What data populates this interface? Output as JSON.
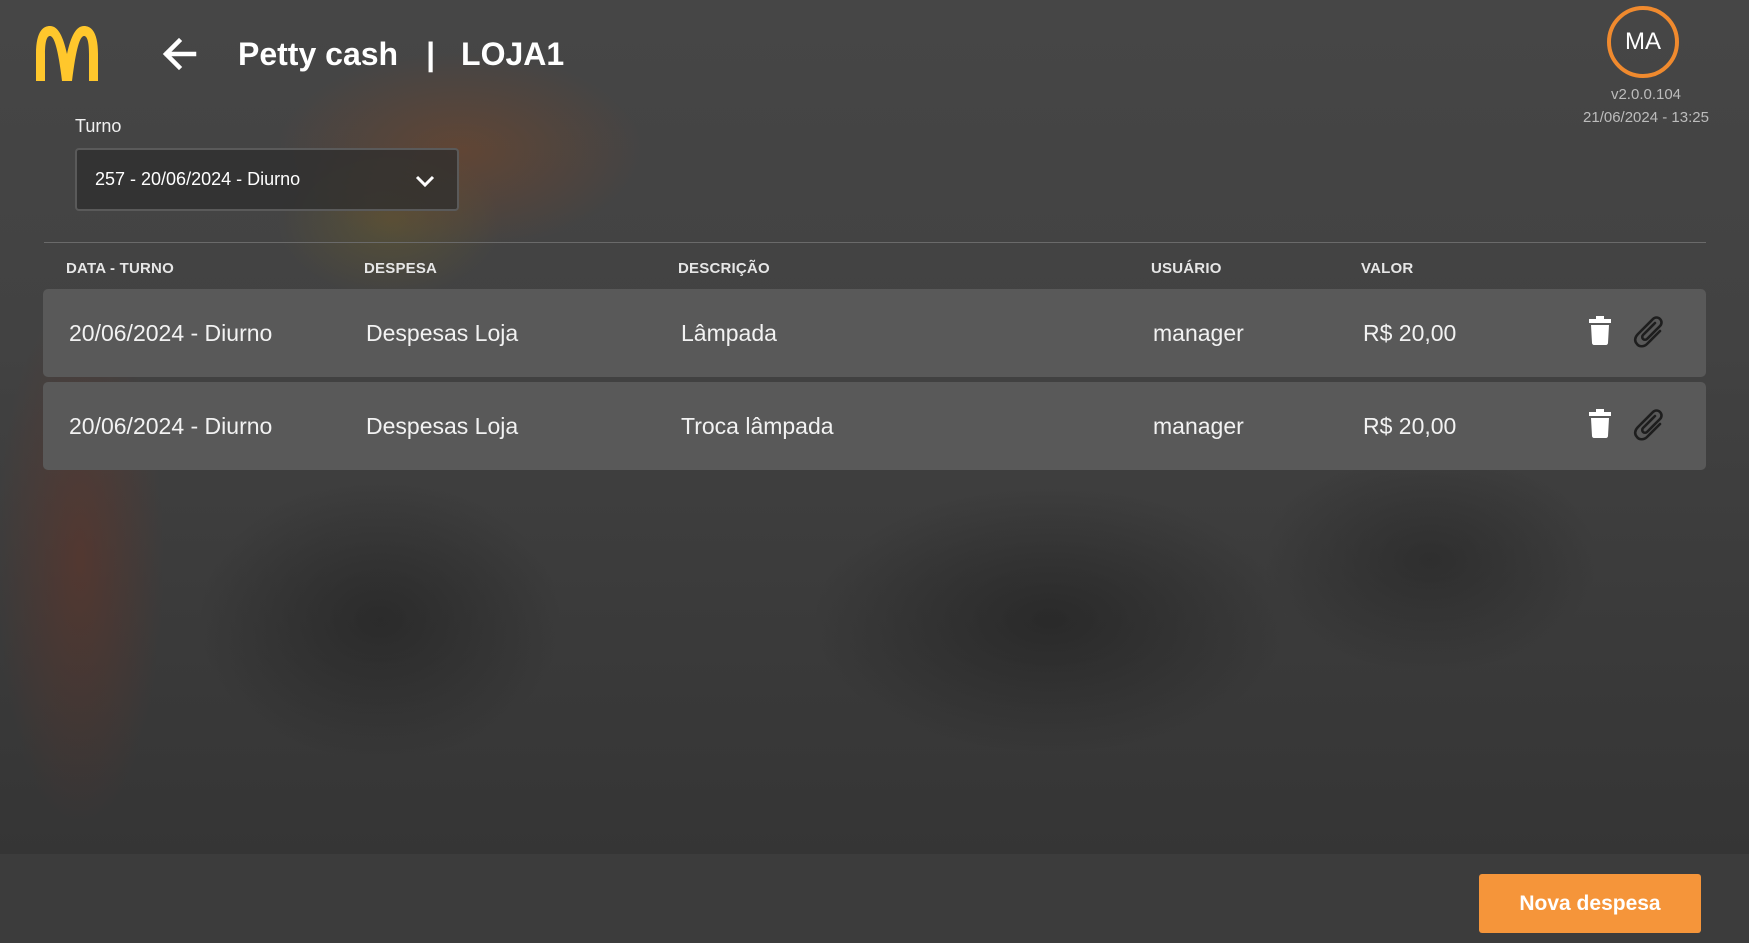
{
  "header": {
    "title": "Petty cash",
    "separator": "|",
    "store": "LOJA1",
    "avatar_initials": "MA",
    "version": "v2.0.0.104",
    "datetime": "21/06/2024 - 13:25"
  },
  "filter": {
    "label": "Turno",
    "selected": "257 - 20/06/2024 - Diurno"
  },
  "table": {
    "columns": [
      "DATA - TURNO",
      "DESPESA",
      "DESCRIÇÃO",
      "USUÁRIO",
      "VALOR"
    ],
    "rows": [
      {
        "data_turno": "20/06/2024 - Diurno",
        "despesa": "Despesas Loja",
        "descricao": "Lâmpada",
        "usuario": "manager",
        "valor": "R$ 20,00"
      },
      {
        "data_turno": "20/06/2024 - Diurno",
        "despesa": "Despesas Loja",
        "descricao": "Troca lâmpada",
        "usuario": "manager",
        "valor": "R$ 20,00"
      }
    ]
  },
  "footer": {
    "new_expense_label": "Nova despesa"
  },
  "colors": {
    "accent": "#f5953a",
    "logo": "#ffc72c",
    "row_bg": "#595959",
    "avatar_ring": "#f08a2e"
  },
  "icons": {
    "logo": "golden-arches-logo",
    "back": "arrow-left-icon",
    "dropdown": "chevron-down-icon",
    "delete": "trash-icon",
    "attach": "paperclip-icon"
  }
}
